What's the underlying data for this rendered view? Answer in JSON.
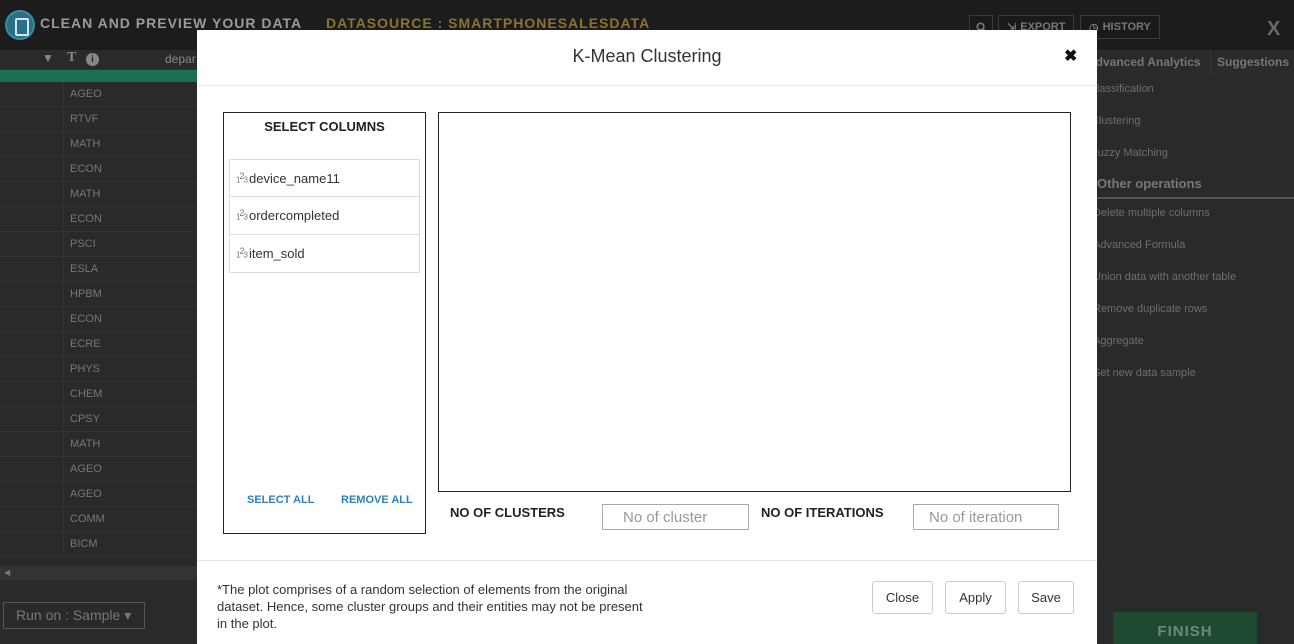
{
  "app": {
    "title": "CLEAN AND PREVIEW YOUR DATA",
    "datasource": "DATASOURCE : SMARTPHONESALESDATA",
    "search_icon": "search-icon",
    "export_label": "EXPORT",
    "history_label": "HISTORY",
    "close_glyph": "X"
  },
  "grid": {
    "column_name": "depar",
    "rows": [
      "AGEO",
      "RTVF",
      "MATH",
      "ECON",
      "MATH",
      "ECON",
      "PSCI",
      "ESLA",
      "HPBM",
      "ECON",
      "ECRE",
      "PHYS",
      "CHEM",
      "CPSY",
      "MATH",
      "AGEO",
      "AGEO",
      "COMM",
      "BICM"
    ],
    "run_on_label": "Run on : Sample"
  },
  "right_panel": {
    "tab_advanced": "Advanced Analytics",
    "tab_suggestions": "Suggestions",
    "analytics_items": [
      "Classification",
      "Clustering",
      "Fuzzy Matching"
    ],
    "other_heading": "Other operations",
    "other_items": [
      "Delete multiple columns",
      "Advanced Formula",
      "Union data with another table",
      "Remove duplicate rows",
      "Aggregate",
      "Set new data sample"
    ],
    "finish_label": "FINISH"
  },
  "modal": {
    "title": "K-Mean Clustering",
    "close_glyph": "✖",
    "select_columns_title": "SELECT COLUMNS",
    "columns": [
      {
        "name": "device_name11"
      },
      {
        "name": "ordercompleted"
      },
      {
        "name": "item_sold"
      }
    ],
    "select_all": "SELECT ALL",
    "remove_all": "REMOVE ALL",
    "clusters_label": "NO OF CLUSTERS",
    "clusters_placeholder": "No of cluster",
    "iterations_label": "NO OF ITERATIONS",
    "iterations_placeholder": "No of iteration",
    "footnote": "*The plot comprises of a random selection of elements from the original dataset. Hence, some cluster groups and their entities may not be present in the plot.",
    "btn_close": "Close",
    "btn_apply": "Apply",
    "btn_save": "Save"
  }
}
